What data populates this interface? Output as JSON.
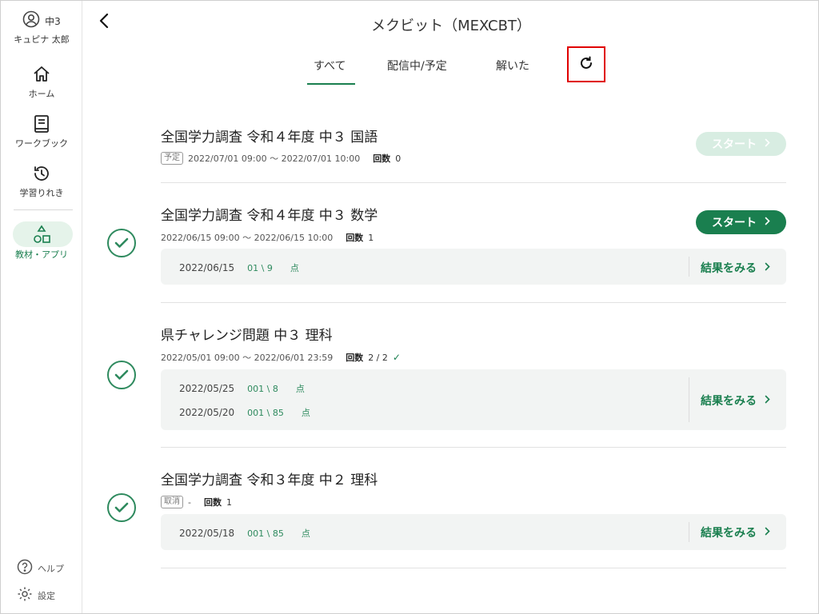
{
  "sidebar": {
    "user": {
      "grade": "中3",
      "name": "キュピナ 太郎"
    },
    "items": [
      {
        "label": "ホーム",
        "icon": "home-icon"
      },
      {
        "label": "ワークブック",
        "icon": "book-icon"
      },
      {
        "label": "学習りれき",
        "icon": "history-icon"
      },
      {
        "label": "教材・アプリ",
        "icon": "shapes-icon"
      }
    ],
    "help_label": "ヘルプ",
    "settings_label": "設定"
  },
  "header": {
    "title": "メクビット（MEXCBT）",
    "tabs": [
      {
        "label": "すべて",
        "active": true
      },
      {
        "label": "配信中/予定",
        "active": false
      },
      {
        "label": "解いた",
        "active": false
      }
    ]
  },
  "labels": {
    "start": "スタート",
    "view_results": "結果をみる",
    "count": "回数",
    "point": "点"
  },
  "tests": [
    {
      "title": "全国学力調査 令和４年度 中３ 国語",
      "tag": "予定",
      "period": "2022/07/01 09:00 ～ 2022/07/01 10:00",
      "count": "0",
      "results": []
    },
    {
      "title": "全国学力調査 令和４年度 中３ 数学",
      "period": "2022/06/15 09:00 ～ 2022/06/15 10:00",
      "count": "1",
      "results": [
        {
          "date": "2022/06/15",
          "score": "01",
          "total": "9",
          "score_total_text": "01 \\ 9"
        }
      ]
    },
    {
      "title": "県チャレンジ問題 中３ 理科",
      "period": "2022/05/01 09:00 ～ 2022/06/01 23:59",
      "count": "2 / 2",
      "results": [
        {
          "date": "2022/05/25",
          "score_total_text": "001 \\ 8"
        },
        {
          "date": "2022/05/20",
          "score_total_text": "001 \\ 85"
        }
      ]
    },
    {
      "title": "全国学力調査 令和３年度 中２ 理科",
      "tag": "取消",
      "period": "-",
      "count": "1",
      "results": [
        {
          "date": "2022/05/18",
          "score_total_text": "001 \\ 85"
        }
      ]
    }
  ],
  "colors": {
    "accent": "#1a7f4f",
    "accent_light": "#d8ede2",
    "highlight_border": "#e00000"
  }
}
